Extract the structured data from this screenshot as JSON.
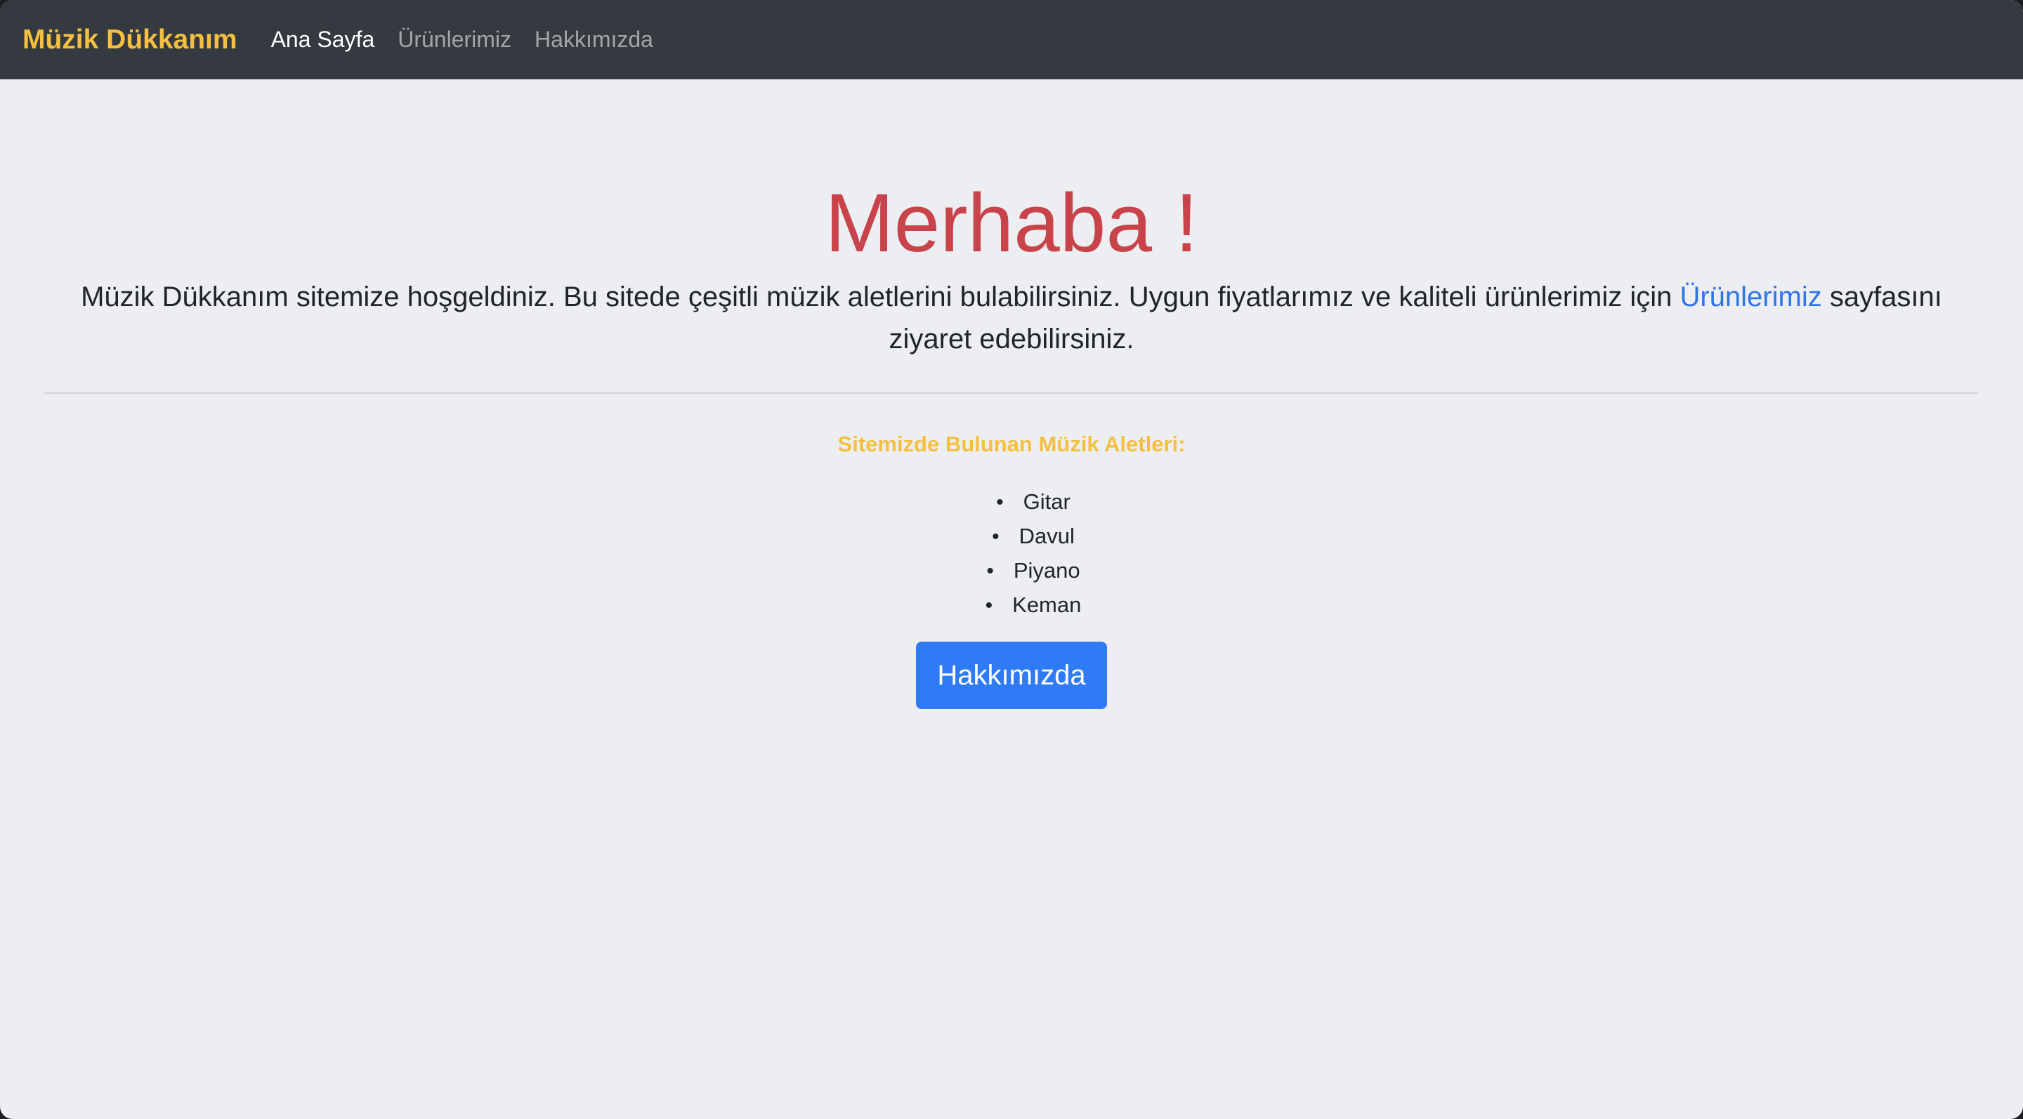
{
  "navbar": {
    "brand": "Müzik Dükkanım",
    "links": [
      {
        "label": "Ana Sayfa",
        "active": true
      },
      {
        "label": "Ürünlerimiz",
        "active": false
      },
      {
        "label": "Hakkımızda",
        "active": false
      }
    ]
  },
  "hero": {
    "title": "Merhaba !",
    "lead_before": "Müzik Dükkanım sitemize hoşgeldiniz. Bu sitede çeşitli müzik aletlerini bulabilirsiniz. Uygun fiyatlarımız ve kaliteli ürünlerimiz için ",
    "lead_link": "Ürünlerimiz",
    "lead_after": " sayfasını ziyaret edebilirsiniz."
  },
  "instruments": {
    "heading": "Sitemizde Bulunan Müzik Aletleri:",
    "items": [
      "Gitar",
      "Davul",
      "Piyano",
      "Keman"
    ]
  },
  "about_button": {
    "label": "Hakkımızda"
  },
  "colors": {
    "navbar_bg": "#343a40",
    "brand": "#f5bf42",
    "title": "#c9434a",
    "link": "#2f74e8",
    "button": "#2f7bf5",
    "page_bg": "#eceef2"
  }
}
